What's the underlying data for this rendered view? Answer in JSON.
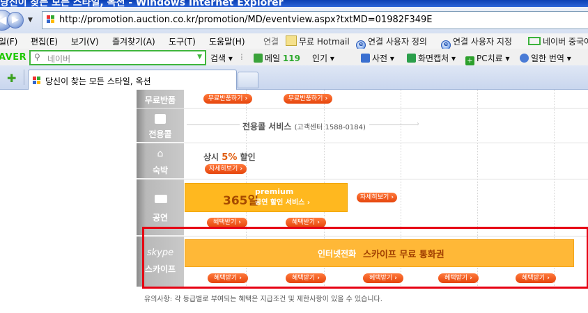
{
  "window": {
    "title": "당신이 찾는 모든 스타일, 옥션 - Windows Internet Explorer"
  },
  "address": {
    "url": "http://promotion.auction.co.kr/promotion/MD/eventview.aspx?txtMD=01982F349E"
  },
  "menu": {
    "items": [
      "일(F)",
      "편집(E)",
      "보기(V)",
      "즐겨찾기(A)",
      "도구(T)",
      "도움말(H)"
    ],
    "links_label": "연결",
    "links": [
      "무료 Hotmail",
      "연결 사용자 정의",
      "연결 사용자 지정",
      "네이버 중국어"
    ]
  },
  "naver": {
    "logo": "AVER",
    "search_placeholder": "네이버",
    "search_label": "검색",
    "mail_label": "메일",
    "mail_count": "119",
    "popular": "인기",
    "dict": "사전",
    "capture": "화면캡처",
    "pc": "PC치료",
    "jp": "일한 번역"
  },
  "tabs": [
    {
      "label": "당신이 찾는 모든 스타일, 옥션"
    }
  ],
  "content": {
    "rows": [
      {
        "category": "무료반품",
        "buttons": [
          "무료반품하기",
          "무료반품하기"
        ]
      },
      {
        "category": "전용콜",
        "service": "전용콜 서비스",
        "service_note": "(고객센터 1588-0184)"
      },
      {
        "category": "숙박",
        "text_prefix": "상시",
        "text_pct": "5%",
        "text_suffix": "할인",
        "button": "자세히보기"
      },
      {
        "category": "공연",
        "banner_big": "365일",
        "banner_pre": "premium",
        "banner_sub": "공연 할인 서비스",
        "side_button": "자세히보기",
        "buttons": [
          "혜택받기",
          "혜택받기"
        ]
      },
      {
        "category_logo": "skype",
        "category": "스카이프",
        "banner_t1": "인터넷전화",
        "banner_t2": "스카이프 무료 통화권",
        "buttons": [
          "혜택받기",
          "혜택받기",
          "혜택받기",
          "혜택받기",
          "혜택받기"
        ]
      }
    ],
    "notice": "유의사항: 각 등급별로 부여되는 혜택은 지급조건 및 제한사항이 있을 수 있습니다."
  }
}
